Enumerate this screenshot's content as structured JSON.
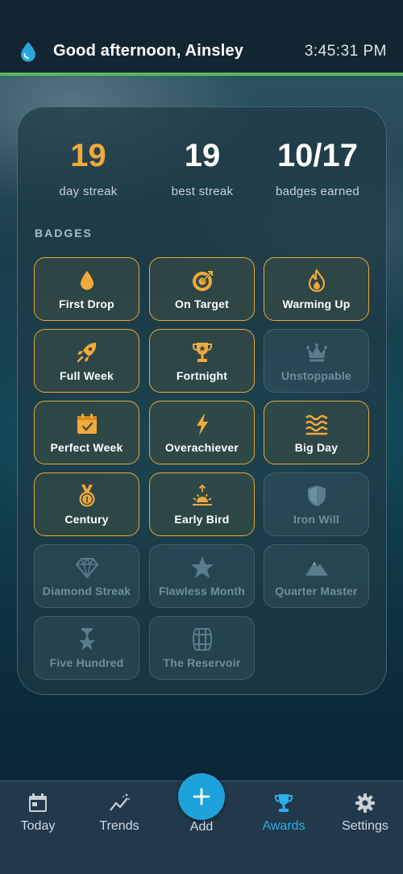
{
  "header": {
    "greeting": "Good afternoon, Ainsley",
    "time": "3:45:31 PM",
    "logo_icon": "water-drop-icon"
  },
  "stats": [
    {
      "value": "19",
      "label": "day streak"
    },
    {
      "value": "19",
      "label": "best streak"
    },
    {
      "value": "10/17",
      "label": "badges earned"
    }
  ],
  "badges_title": "BADGES",
  "badges": [
    {
      "name": "First Drop",
      "icon": "drop-icon",
      "earned": true
    },
    {
      "name": "On Target",
      "icon": "target-icon",
      "earned": true
    },
    {
      "name": "Warming Up",
      "icon": "flame-icon",
      "earned": true
    },
    {
      "name": "Full Week",
      "icon": "rocket-icon",
      "earned": true
    },
    {
      "name": "Fortnight",
      "icon": "trophy-icon",
      "earned": true
    },
    {
      "name": "Unstoppable",
      "icon": "crown-icon",
      "earned": false
    },
    {
      "name": "Perfect Week",
      "icon": "calendar-check-icon",
      "earned": true
    },
    {
      "name": "Overachiever",
      "icon": "bolt-icon",
      "earned": true
    },
    {
      "name": "Big Day",
      "icon": "waves-icon",
      "earned": true
    },
    {
      "name": "Century",
      "icon": "medal-icon",
      "earned": true
    },
    {
      "name": "Early Bird",
      "icon": "sunrise-icon",
      "earned": true
    },
    {
      "name": "Iron Will",
      "icon": "shield-icon",
      "earned": false
    },
    {
      "name": "Diamond Streak",
      "icon": "diamond-icon",
      "earned": false
    },
    {
      "name": "Flawless Month",
      "icon": "star-icon",
      "earned": false
    },
    {
      "name": "Quarter Master",
      "icon": "mountain-icon",
      "earned": false
    },
    {
      "name": "Five Hundred",
      "icon": "star-trophy-icon",
      "earned": false
    },
    {
      "name": "The Reservoir",
      "icon": "barrel-icon",
      "earned": false
    }
  ],
  "nav": {
    "items": [
      {
        "label": "Today",
        "icon": "calendar-icon",
        "active": false
      },
      {
        "label": "Trends",
        "icon": "trend-icon",
        "active": false
      },
      {
        "label": "Add",
        "icon": "plus-icon",
        "active": false
      },
      {
        "label": "Awards",
        "icon": "trophy-icon",
        "active": true
      },
      {
        "label": "Settings",
        "icon": "gear-icon",
        "active": false
      }
    ]
  },
  "colors": {
    "accent_gold": "#f2a93b",
    "accent_blue": "#1ea2db",
    "progress_green": "#5cb85c"
  }
}
